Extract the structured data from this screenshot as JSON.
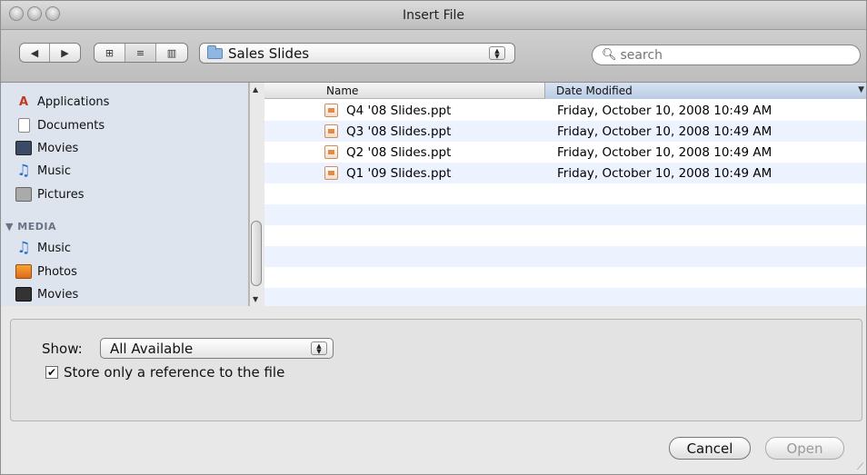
{
  "window": {
    "title": "Insert File"
  },
  "toolbar": {
    "back_glyph": "◀",
    "forward_glyph": "▶",
    "view_icon_glyph": "⊞",
    "view_list_glyph": "≡",
    "view_column_glyph": "▥",
    "location": "Sales Slides",
    "search_placeholder": "search"
  },
  "sidebar": {
    "places": [
      {
        "label": "Applications",
        "icon": "applications-icon"
      },
      {
        "label": "Documents",
        "icon": "documents-icon"
      },
      {
        "label": "Movies",
        "icon": "movies-icon"
      },
      {
        "label": "Music",
        "icon": "music-icon"
      },
      {
        "label": "Pictures",
        "icon": "pictures-icon"
      }
    ],
    "media_header": "▼ MEDIA",
    "media": [
      {
        "label": "Music",
        "icon": "itunes-music-icon"
      },
      {
        "label": "Photos",
        "icon": "iphoto-icon"
      },
      {
        "label": "Movies",
        "icon": "clapper-icon"
      }
    ]
  },
  "filelist": {
    "columns": {
      "name": "Name",
      "date": "Date Modified"
    },
    "files": [
      {
        "name": "Q4 '08 Slides.ppt",
        "date": "Friday, October 10, 2008 10:49 AM"
      },
      {
        "name": "Q3 '08 Slides.ppt",
        "date": "Friday, October 10, 2008 10:49 AM"
      },
      {
        "name": "Q2 '08 Slides.ppt",
        "date": "Friday, October 10, 2008 10:49 AM"
      },
      {
        "name": "Q1 '09 Slides.ppt",
        "date": "Friday, October 10, 2008 10:49 AM"
      }
    ]
  },
  "options": {
    "show_label": "Show:",
    "show_value": "All Available",
    "reference_label": "Store only a reference to the file",
    "reference_checked": true
  },
  "buttons": {
    "cancel": "Cancel",
    "open": "Open"
  }
}
